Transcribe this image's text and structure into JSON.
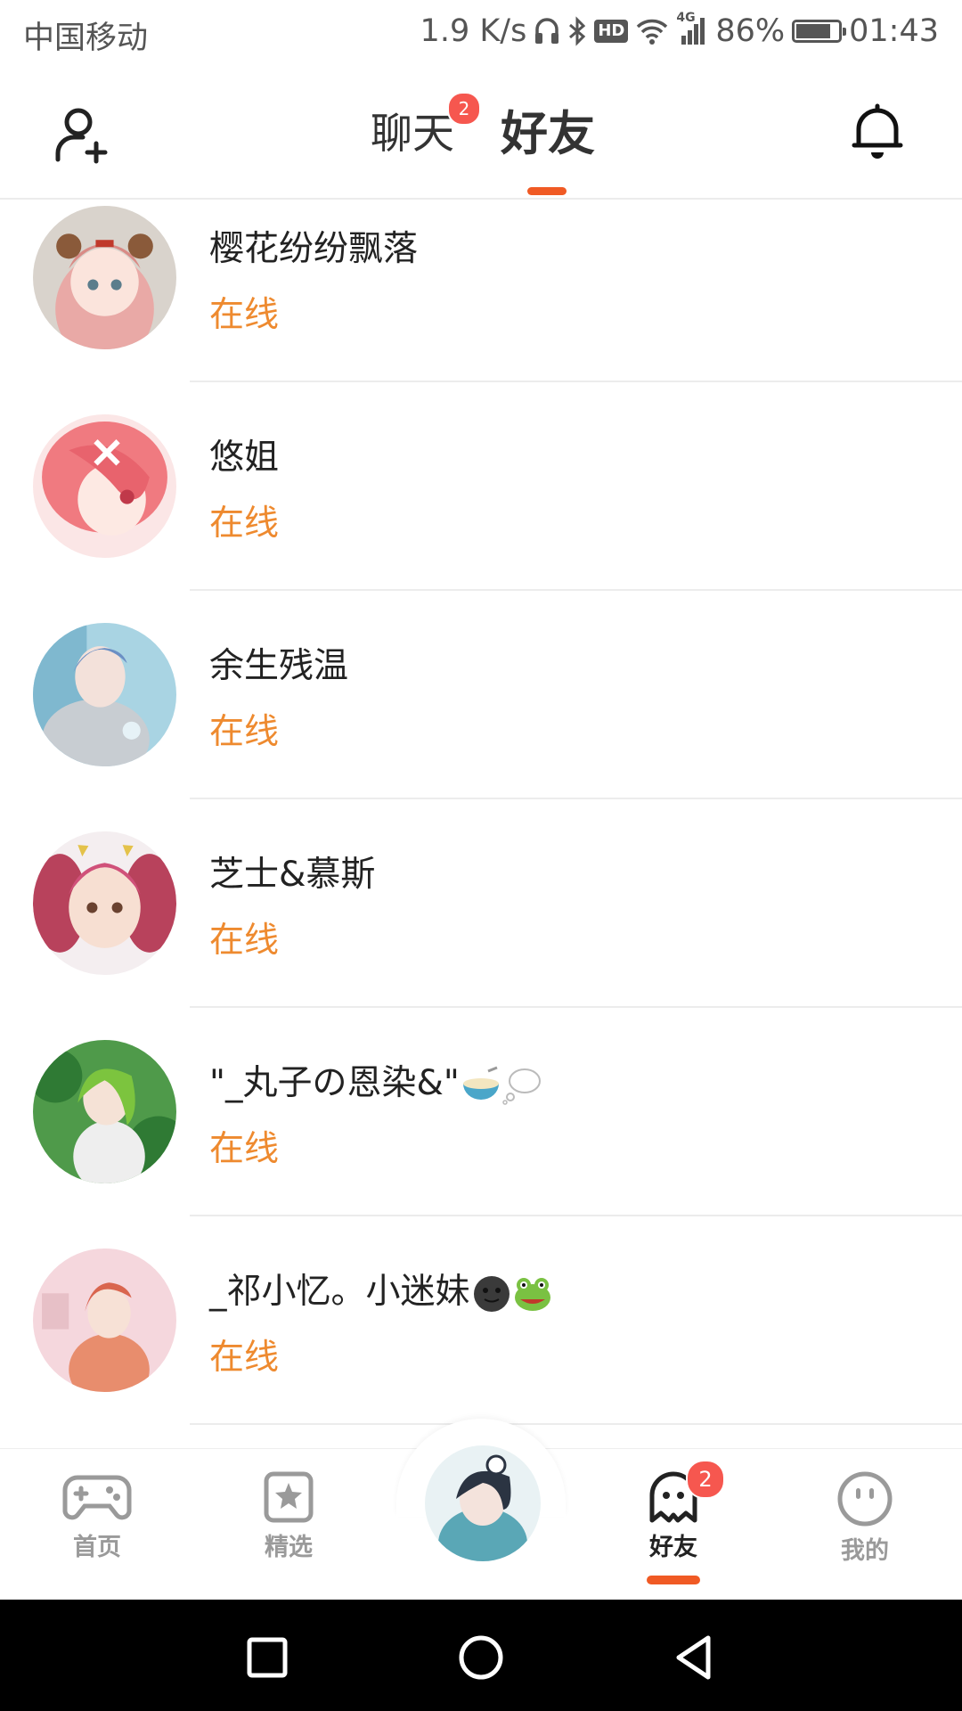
{
  "status_bar": {
    "carrier": "中国移动",
    "speed": "1.9 K/s",
    "hd_badge": "HD",
    "network": "4G",
    "battery_text": "86%",
    "battery_level": 0.86,
    "time": "01:43"
  },
  "header": {
    "tabs": [
      {
        "label": "聊天",
        "badge": "2",
        "active": false
      },
      {
        "label": "好友",
        "active": true
      }
    ],
    "accent_color": "#f05a24"
  },
  "friends": [
    {
      "name": "樱花纷纷飘落",
      "status": "在线",
      "avatar": "avatar-sakura"
    },
    {
      "name": "悠姐",
      "status": "在线",
      "avatar": "avatar-pink-hair"
    },
    {
      "name": "余生残温",
      "status": "在线",
      "avatar": "avatar-blue-hair"
    },
    {
      "name": "芝士&慕斯",
      "status": "在线",
      "avatar": "avatar-twin-tails"
    },
    {
      "name": "\"_丸子の恩染&\"",
      "status": "在线",
      "avatar": "avatar-green-hair",
      "emojis": [
        "bowl-emoji",
        "thought-bubble-emoji"
      ]
    },
    {
      "name": "_祁小忆。小迷妹",
      "status": "在线",
      "avatar": "avatar-red-hair-boy",
      "emojis": [
        "dark-face-emoji",
        "frog-emoji"
      ]
    }
  ],
  "bottom_nav": {
    "items": [
      {
        "label": "首页",
        "icon": "gamepad-icon"
      },
      {
        "label": "精选",
        "icon": "star-bookmark-icon"
      },
      {
        "label": "",
        "icon": "center-avatar"
      },
      {
        "label": "好友",
        "icon": "ghost-icon",
        "badge": "2",
        "active": true
      },
      {
        "label": "我的",
        "icon": "smiley-icon"
      }
    ]
  },
  "colors": {
    "online": "#ee8a2f",
    "badge": "#f6574f",
    "accent": "#f05a24"
  }
}
